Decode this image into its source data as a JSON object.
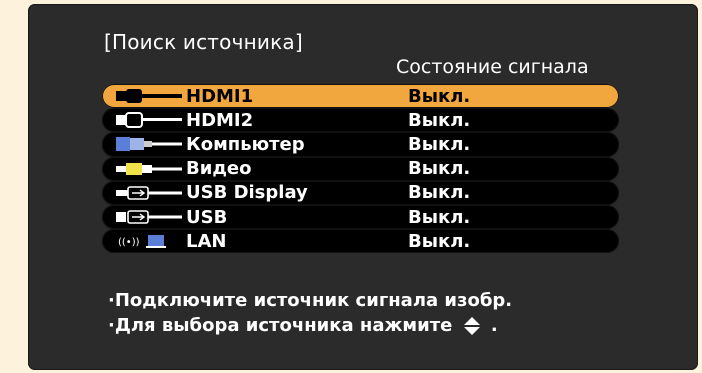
{
  "title": "[Поиск источника]",
  "column_header": "Состояние сигнала",
  "sources": [
    {
      "name": "HDMI1",
      "status": "Выкл.",
      "icon": "hdmi-cable-icon",
      "selected": true
    },
    {
      "name": "HDMI2",
      "status": "Выкл.",
      "icon": "hdmi-cable-icon",
      "selected": false
    },
    {
      "name": "Компьютер",
      "status": "Выкл.",
      "icon": "vga-cable-icon",
      "selected": false
    },
    {
      "name": "Видео",
      "status": "Выкл.",
      "icon": "rca-cable-icon",
      "selected": false
    },
    {
      "name": "USB Display",
      "status": "Выкл.",
      "icon": "usb-cable-icon",
      "selected": false
    },
    {
      "name": "USB",
      "status": "Выкл.",
      "icon": "usb-cable-icon",
      "selected": false
    },
    {
      "name": "LAN",
      "status": "Выкл.",
      "icon": "wireless-lan-icon",
      "selected": false
    }
  ],
  "hints": {
    "line1": "·Подключите источник сигнала изобр.",
    "line2_prefix": "·Для выбора источника нажмите",
    "line2_suffix": "."
  },
  "colors": {
    "selected_row": "#f2a73e",
    "panel": "#2b2b2b",
    "row": "#000000"
  }
}
